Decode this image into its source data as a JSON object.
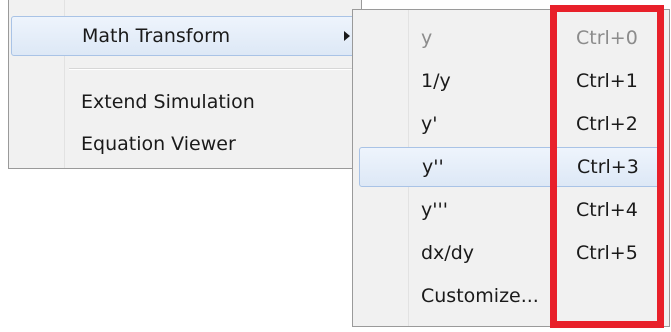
{
  "main_menu": {
    "items": [
      {
        "label": "Math Transform",
        "has_submenu": true,
        "highlighted": true,
        "submenu_icon": "chevron-right-icon"
      },
      {
        "label": "Extend Simulation",
        "has_submenu": false,
        "highlighted": false
      },
      {
        "label": "Equation Viewer",
        "has_submenu": false,
        "highlighted": false
      }
    ]
  },
  "submenu": {
    "items": [
      {
        "label": "y",
        "shortcut": "Ctrl+0",
        "enabled": false,
        "highlighted": false
      },
      {
        "label": "1/y",
        "shortcut": "Ctrl+1",
        "enabled": true,
        "highlighted": false
      },
      {
        "label": "y'",
        "shortcut": "Ctrl+2",
        "enabled": true,
        "highlighted": false
      },
      {
        "label": "y''",
        "shortcut": "Ctrl+3",
        "enabled": true,
        "highlighted": true
      },
      {
        "label": "y'''",
        "shortcut": "Ctrl+4",
        "enabled": true,
        "highlighted": false
      },
      {
        "label": "dx/dy",
        "shortcut": "Ctrl+5",
        "enabled": true,
        "highlighted": false
      },
      {
        "label": "Customize...",
        "shortcut": "",
        "enabled": true,
        "highlighted": false
      }
    ]
  },
  "annotation": {
    "color": "#e8202a",
    "target": "shortcut column"
  },
  "colors": {
    "menu_background": "#f1f1f1",
    "highlight_background": "#dde8f6",
    "highlight_border": "#a9c3e6",
    "disabled_text": "#8c8c8c"
  }
}
